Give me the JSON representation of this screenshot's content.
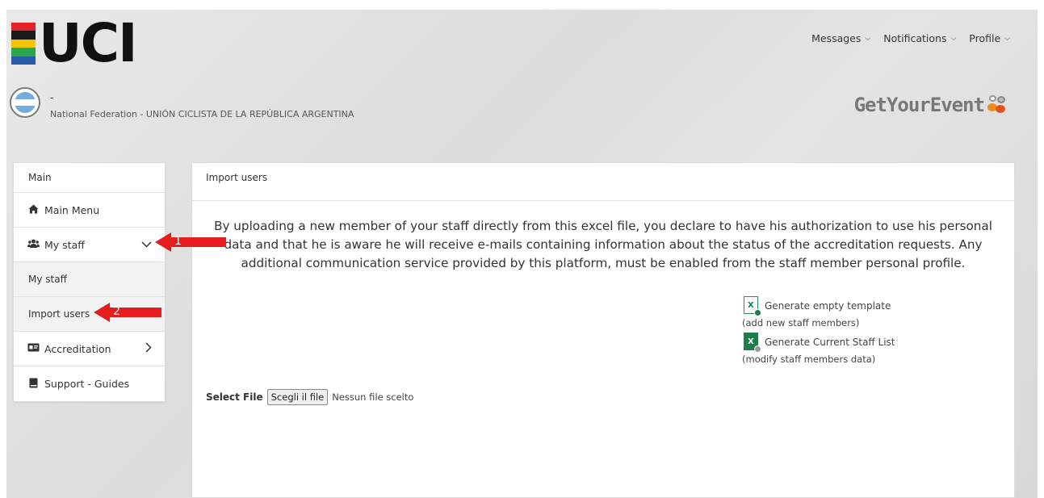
{
  "brand": {
    "logo_text": "UCI",
    "stripe_colors": [
      "#e5222a",
      "#1a1a1a",
      "#f5c400",
      "#2aa64a",
      "#2a5da8"
    ]
  },
  "topnav": {
    "items": [
      {
        "label": "Messages",
        "icon": "chevron-down-icon"
      },
      {
        "label": "Notifications",
        "icon": "chevron-down-icon"
      },
      {
        "label": "Profile",
        "icon": "chevron-down-icon"
      }
    ]
  },
  "federation": {
    "user_name": "-",
    "name": "National Federation - UNIÓN CICLISTA DE LA REPÚBLICA ARGENTINA",
    "flag_icon": "argentina-flag-icon"
  },
  "partner_logo": {
    "text": "GetYourEvent"
  },
  "sidebar": {
    "header": "Main",
    "items": [
      {
        "label": "Main Menu",
        "icon": "home-icon"
      },
      {
        "label": "My staff",
        "icon": "users-icon",
        "expander": "chevron-down-icon"
      },
      {
        "label": "My staff"
      },
      {
        "label": "Import users"
      },
      {
        "label": "Accreditation",
        "icon": "id-card-icon",
        "expander": "chevron-right-icon"
      },
      {
        "label": "Support - Guides",
        "icon": "book-icon"
      }
    ]
  },
  "main": {
    "title": "Import users",
    "notice": "By uploading a new member of your staff directly from this excel file, you declare to have his authorization to use his personal data and that he is aware he will receive e-mails containing information about the status of the accreditation requests. Any additional communication service provided by this platform, must be enabled from the staff member personal profile.",
    "templates": {
      "empty_label": "Generate empty template",
      "empty_sub": "(add new staff members)",
      "current_label": "Generate Current Staff List",
      "current_sub": "(modify staff members data)"
    },
    "file": {
      "label": "Select File",
      "button": "Scegli il file",
      "status": "Nessun file scelto"
    }
  },
  "annotations": {
    "arrow1": "1",
    "arrow2": "2",
    "color": "#e51d1d"
  }
}
